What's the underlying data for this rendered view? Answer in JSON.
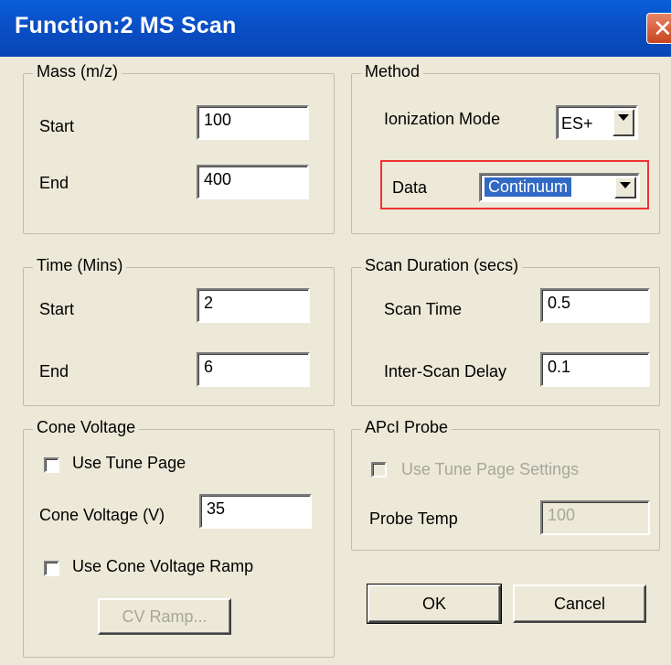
{
  "window": {
    "title": "Function:2 MS Scan",
    "close_glyph": "✕"
  },
  "mass": {
    "legend": "Mass (m/z)",
    "start_label": "Start",
    "start_value": "100",
    "end_label": "End",
    "end_value": "400"
  },
  "method": {
    "legend": "Method",
    "ionization_label": "Ionization Mode",
    "ionization_value": "ES+",
    "data_label": "Data",
    "data_value": "Continuum"
  },
  "time": {
    "legend": "Time (Mins)",
    "start_label": "Start",
    "start_value": "2",
    "end_label": "End",
    "end_value": "6"
  },
  "scan_duration": {
    "legend": "Scan Duration (secs)",
    "scan_time_label": "Scan Time",
    "scan_time_value": "0.5",
    "inter_scan_label": "Inter-Scan Delay",
    "inter_scan_value": "0.1"
  },
  "cone": {
    "legend": "Cone Voltage",
    "use_tune_page_label": "Use Tune Page",
    "use_tune_page_checked": false,
    "voltage_label": "Cone Voltage (V)",
    "voltage_value": "35",
    "ramp_label": "Use Cone Voltage Ramp",
    "ramp_checked": false,
    "cv_ramp_button": "CV Ramp..."
  },
  "apci": {
    "legend": "APcI Probe",
    "use_tune_settings_label": "Use Tune Page Settings",
    "probe_temp_label": "Probe Temp",
    "probe_temp_value": "100"
  },
  "buttons": {
    "ok": "OK",
    "cancel": "Cancel"
  },
  "colors": {
    "title_bar": "#0a4fc6",
    "highlight": "#e33333",
    "dialog_bg": "#ece9d8"
  }
}
